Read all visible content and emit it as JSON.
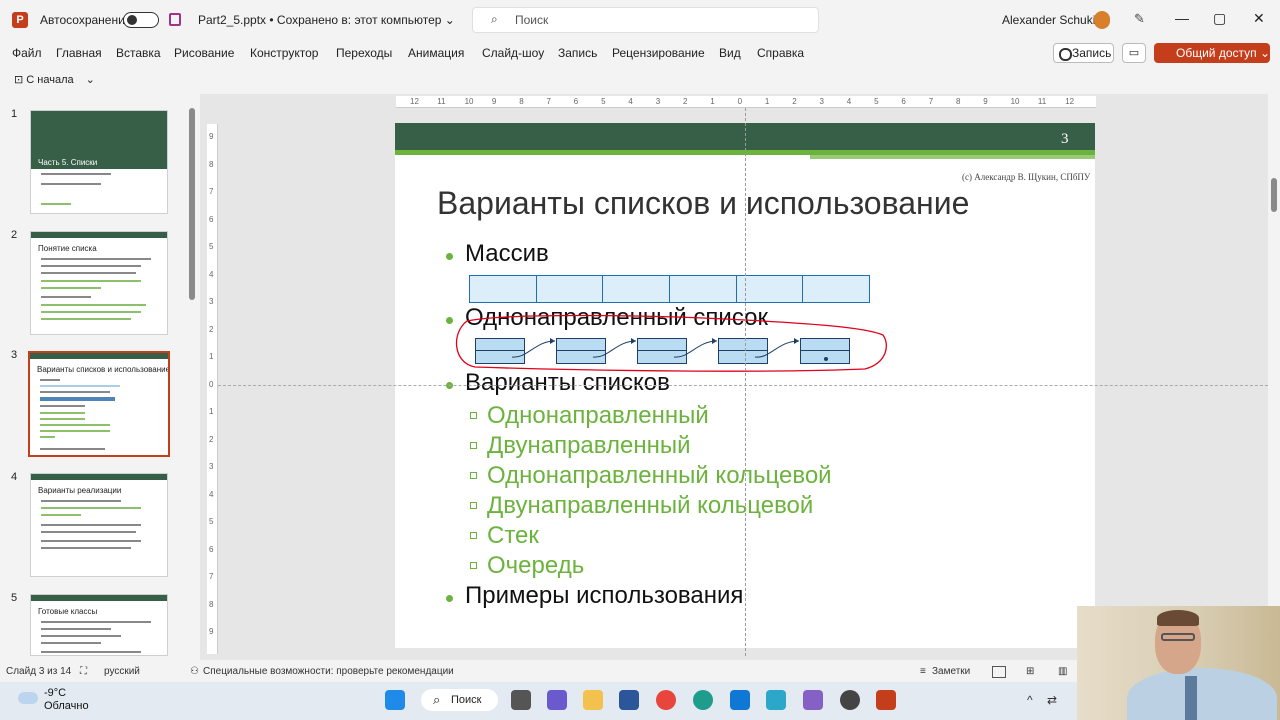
{
  "titlebar": {
    "app_icon_letter": "P",
    "autosave_label": "Автосохранение",
    "doc_title": "Part2_5.pptx • Сохранено в: этот компьютер ⌄",
    "search_placeholder": "Поиск",
    "user_name": "Alexander Schukin",
    "minimize": "—",
    "maximize": "▢",
    "close": "✕"
  },
  "menu": {
    "items": [
      "Файл",
      "Главная",
      "Вставка",
      "Рисование",
      "Конструктор",
      "Переходы",
      "Анимация",
      "Слайд-шоу",
      "Запись",
      "Рецензирование",
      "Вид",
      "Справка"
    ],
    "record_label": "Запись",
    "comment_label": "▭",
    "share_label": "Общий доступ ⌄"
  },
  "qat": {
    "start_label": "С начала"
  },
  "thumbnails": [
    {
      "num": "1",
      "title": "Часть 5. Списки"
    },
    {
      "num": "2",
      "title": "Понятие списка"
    },
    {
      "num": "3",
      "title": "Варианты списков и использование"
    },
    {
      "num": "4",
      "title": "Варианты реализации"
    },
    {
      "num": "5",
      "title": "Готовые классы"
    }
  ],
  "ruler": {
    "top": [
      "12",
      "11",
      "10",
      "9",
      "8",
      "7",
      "6",
      "5",
      "4",
      "3",
      "2",
      "1",
      "0",
      "1",
      "2",
      "3",
      "4",
      "5",
      "6",
      "7",
      "8",
      "9",
      "10",
      "11",
      "12"
    ],
    "left": [
      "9",
      "8",
      "7",
      "6",
      "5",
      "4",
      "3",
      "2",
      "1",
      "0",
      "1",
      "2",
      "3",
      "4",
      "5",
      "6",
      "7",
      "8",
      "9"
    ]
  },
  "slide": {
    "number": "3",
    "copyright": "(с) Александр В. Щукин, СПбПУ",
    "title": "Варианты списков и использование",
    "bullets": {
      "array": "Массив",
      "singly": "Однонаправленный список",
      "variants": "Варианты списков",
      "examples": "Примеры использования"
    },
    "sub_bullets": [
      "Однонаправленный",
      "Двунаправленный",
      "Однонаправленный кольцевой",
      "Двунаправленный кольцевой",
      "Стек",
      "Очередь"
    ],
    "colors": {
      "header": "#375f47",
      "accent": "#6cb33e",
      "node_fill": "#b9dcf2",
      "annotation": "#e0001a"
    }
  },
  "status": {
    "slide_counter": "Слайд 3 из 14",
    "language": "русский",
    "accessibility": "Специальные возможности: проверьте рекомендации",
    "notes": "Заметки"
  },
  "taskbar": {
    "temperature": "-9°C",
    "weather": "Облачно",
    "search_label": "Поиск"
  }
}
